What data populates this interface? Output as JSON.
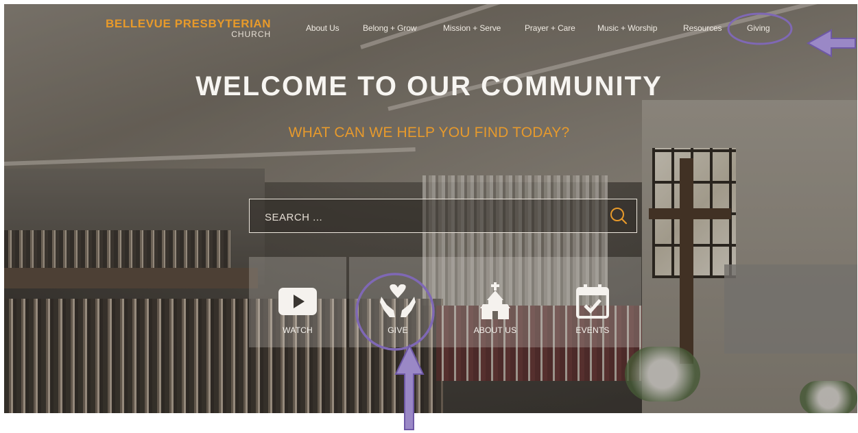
{
  "header": {
    "logo_main": "BELLEVUE PRESBYTERIAN",
    "logo_sub": "CHURCH",
    "nav": [
      {
        "label": "About Us"
      },
      {
        "label": "Belong + Grow"
      },
      {
        "label": "Mission + Serve"
      },
      {
        "label": "Prayer + Care"
      },
      {
        "label": "Music + Worship"
      },
      {
        "label": "Resources"
      },
      {
        "label": "Giving"
      }
    ]
  },
  "hero": {
    "title": "WELCOME TO OUR COMMUNITY",
    "subtitle": "WHAT CAN WE HELP YOU FIND TODAY?"
  },
  "search": {
    "placeholder": "SEARCH ..."
  },
  "tiles": [
    {
      "label": "WATCH",
      "icon": "play-icon"
    },
    {
      "label": "GIVE",
      "icon": "heart-hands-icon"
    },
    {
      "label": "ABOUT US",
      "icon": "church-icon"
    },
    {
      "label": "EVENTS",
      "icon": "calendar-check-icon"
    }
  ],
  "colors": {
    "accent_orange": "#e89a2a",
    "annotation_purple": "#7f68b5"
  }
}
